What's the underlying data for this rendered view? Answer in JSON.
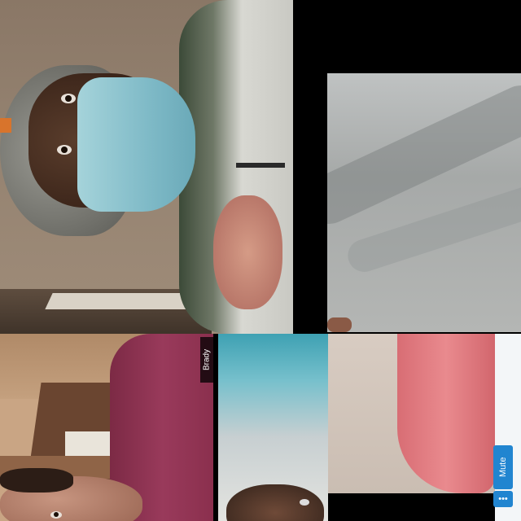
{
  "tiles": [
    {
      "name": "participant-1-video"
    },
    {
      "name": "participant-2-video"
    },
    {
      "name": "participant-3-video",
      "label": "Brady"
    },
    {
      "name": "participant-4-video"
    },
    {
      "name": "participant-5-video"
    }
  ],
  "controls": {
    "mute_label": "Mute",
    "more_label": "•••",
    "accent_color": "#2185d0"
  }
}
